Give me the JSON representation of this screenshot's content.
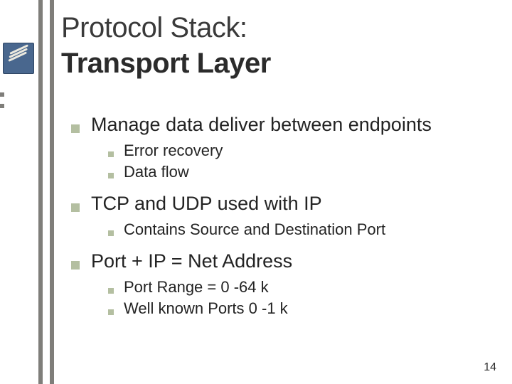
{
  "title": {
    "line1": "Protocol Stack:",
    "line2": "Transport Layer"
  },
  "bullets": [
    {
      "text": "Manage data deliver between endpoints",
      "sub": [
        "Error recovery",
        "Data flow"
      ]
    },
    {
      "text": "TCP and UDP used with IP",
      "sub": [
        "Contains Source and Destination Port"
      ]
    },
    {
      "text": "Port + IP = Net Address",
      "sub": [
        "Port Range = 0 -64 k",
        "Well known Ports 0 -1 k"
      ]
    }
  ],
  "page_number": "14"
}
